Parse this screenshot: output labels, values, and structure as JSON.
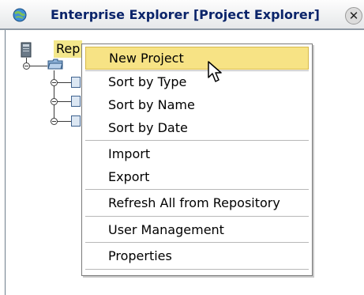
{
  "window": {
    "title": "Enterprise Explorer [Project Explorer]",
    "close_glyph": "✕",
    "title_icon": "globe-tree-icon"
  },
  "tree": {
    "root_label": "Rep",
    "root_icon": "repository-icon",
    "folder_icon": "folder-icon",
    "child_icon": "project-icon"
  },
  "context_menu": {
    "items": [
      {
        "label": "New Project",
        "selected": true
      },
      {
        "label": "Sort by Type"
      },
      {
        "label": "Sort by Name"
      },
      {
        "label": "Sort by Date"
      },
      {
        "label": "Import"
      },
      {
        "label": "Export"
      },
      {
        "label": "Refresh All from Repository"
      },
      {
        "label": "User Management"
      },
      {
        "label": "Properties"
      }
    ]
  },
  "colors": {
    "selection_bg": "#f7e385",
    "title_text": "#0a246a"
  }
}
